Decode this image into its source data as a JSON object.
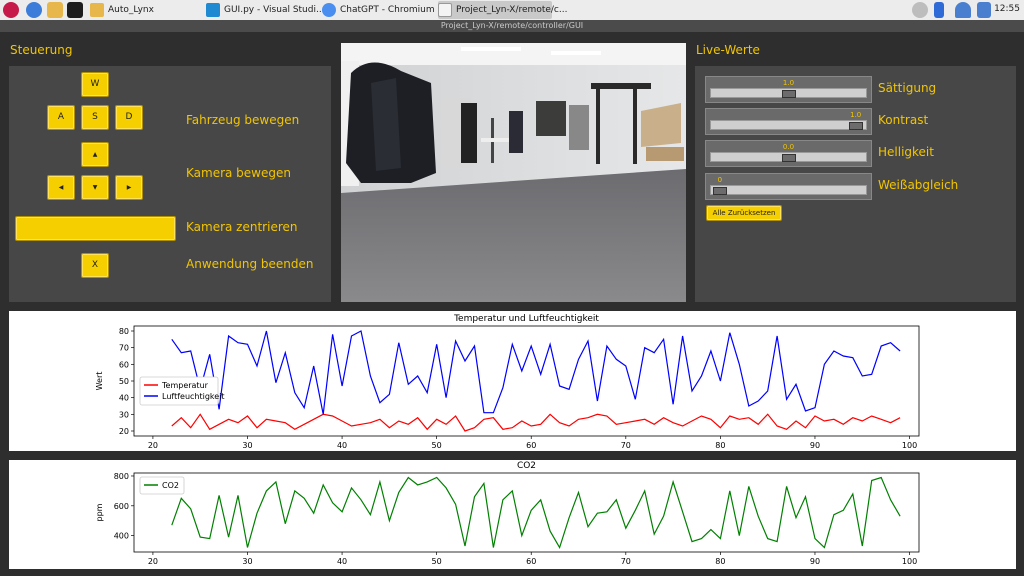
{
  "taskbar": {
    "items": [
      {
        "label": "Auto_Lynx"
      },
      {
        "label": "GUI.py - Visual Studi..."
      },
      {
        "label": "ChatGPT - Chromium"
      },
      {
        "label": "Project_Lyn-X/remote/c..."
      }
    ],
    "clock": "12:55"
  },
  "window": {
    "title": "Project_Lyn-X/remote/controller/GUI"
  },
  "controls": {
    "title": "Steuerung",
    "keys": {
      "w": "W",
      "a": "A",
      "s": "S",
      "d": "D",
      "up": "▲",
      "left": "◀",
      "down": "▼",
      "right": "▶",
      "exit": "X"
    },
    "labels": {
      "move_vehicle": "Fahrzeug bewegen",
      "move_camera": "Kamera bewegen",
      "center_camera": "Kamera zentrieren",
      "exit_app": "Anwendung beenden"
    }
  },
  "live": {
    "title": "Live-Werte",
    "sliders": [
      {
        "label": "Sättigung",
        "value": "1.0",
        "fraction": 0.5
      },
      {
        "label": "Kontrast",
        "value": "1.0",
        "fraction": 0.97
      },
      {
        "label": "Helligkeit",
        "value": "0.0",
        "fraction": 0.5
      },
      {
        "label": "Weißabgleich",
        "value": "0",
        "fraction": 0.02
      }
    ],
    "reset_label": "Alle Zurücksetzen"
  },
  "colors": {
    "accent": "#f2c500",
    "button": "#f6cf00",
    "panel": "#474747",
    "background": "#2e2e2e"
  },
  "chart_data": [
    {
      "type": "line",
      "title": "Temperatur und Luftfeuchtigkeit",
      "xlabel": "",
      "ylabel": "Wert",
      "xlim": [
        18,
        101
      ],
      "ylim": [
        17,
        83
      ],
      "xticks": [
        20,
        30,
        40,
        50,
        60,
        70,
        80,
        90,
        100
      ],
      "yticks": [
        20,
        30,
        40,
        50,
        60,
        70,
        80
      ],
      "legend": "center-left",
      "x": [
        22,
        23,
        24,
        25,
        26,
        27,
        28,
        29,
        30,
        31,
        32,
        33,
        34,
        35,
        36,
        37,
        38,
        39,
        40,
        41,
        42,
        43,
        44,
        45,
        46,
        47,
        48,
        49,
        50,
        51,
        52,
        53,
        54,
        55,
        56,
        57,
        58,
        59,
        60,
        61,
        62,
        63,
        64,
        65,
        66,
        67,
        68,
        69,
        70,
        71,
        72,
        73,
        74,
        75,
        76,
        77,
        78,
        79,
        80,
        81,
        82,
        83,
        84,
        85,
        86,
        87,
        88,
        89,
        90,
        91,
        92,
        93,
        94,
        95,
        96,
        97,
        98,
        99
      ],
      "series": [
        {
          "name": "Temperatur",
          "color": "#ff0000",
          "values": [
            23,
            28,
            22,
            30,
            21,
            24,
            27,
            25,
            29,
            22,
            27,
            26,
            25,
            21,
            24,
            27,
            30,
            29,
            26,
            23,
            24,
            25,
            27,
            22,
            26,
            24,
            28,
            21,
            27,
            24,
            29,
            20,
            22,
            27,
            28,
            21,
            22,
            26,
            23,
            24,
            30,
            25,
            23,
            27,
            28,
            30,
            29,
            24,
            25,
            26,
            27,
            24,
            28,
            25,
            23,
            26,
            29,
            27,
            22,
            29,
            27,
            28,
            24,
            30,
            23,
            21,
            26,
            22,
            29,
            26,
            27,
            24,
            28,
            26,
            29,
            27,
            25,
            28
          ]
        },
        {
          "name": "Luftfeuchtigkeit",
          "color": "#0000ff",
          "values": [
            75,
            67,
            68,
            45,
            66,
            33,
            77,
            73,
            72,
            59,
            80,
            49,
            67,
            43,
            34,
            59,
            30,
            78,
            47,
            77,
            80,
            53,
            37,
            42,
            73,
            48,
            53,
            43,
            72,
            40,
            74,
            62,
            71,
            31,
            31,
            46,
            72,
            56,
            71,
            54,
            72,
            47,
            45,
            63,
            74,
            38,
            71,
            63,
            59,
            39,
            70,
            67,
            75,
            36,
            77,
            44,
            53,
            68,
            50,
            79,
            60,
            35,
            38,
            44,
            77,
            39,
            48,
            32,
            34,
            60,
            68,
            65,
            64,
            53,
            54,
            71,
            73,
            68
          ]
        }
      ]
    },
    {
      "type": "line",
      "title": "CO2",
      "xlabel": "",
      "ylabel": "ppm",
      "xlim": [
        18,
        101
      ],
      "ylim": [
        290,
        820
      ],
      "xticks": [
        20,
        30,
        40,
        50,
        60,
        70,
        80,
        90,
        100
      ],
      "yticks": [
        400,
        600,
        800
      ],
      "legend": "top-left",
      "x": [
        22,
        23,
        24,
        25,
        26,
        27,
        28,
        29,
        30,
        31,
        32,
        33,
        34,
        35,
        36,
        37,
        38,
        39,
        40,
        41,
        42,
        43,
        44,
        45,
        46,
        47,
        48,
        49,
        50,
        51,
        52,
        53,
        54,
        55,
        56,
        57,
        58,
        59,
        60,
        61,
        62,
        63,
        64,
        65,
        66,
        67,
        68,
        69,
        70,
        71,
        72,
        73,
        74,
        75,
        76,
        77,
        78,
        79,
        80,
        81,
        82,
        83,
        84,
        85,
        86,
        87,
        88,
        89,
        90,
        91,
        92,
        93,
        94,
        95,
        96,
        97,
        98,
        99
      ],
      "series": [
        {
          "name": "CO2",
          "color": "#008000",
          "values": [
            470,
            650,
            580,
            390,
            380,
            670,
            390,
            670,
            320,
            550,
            700,
            760,
            480,
            700,
            650,
            550,
            740,
            620,
            560,
            720,
            640,
            540,
            760,
            500,
            690,
            790,
            740,
            760,
            790,
            720,
            610,
            330,
            660,
            750,
            320,
            640,
            700,
            400,
            570,
            640,
            430,
            320,
            520,
            690,
            460,
            550,
            560,
            640,
            450,
            570,
            700,
            410,
            530,
            760,
            560,
            360,
            380,
            440,
            380,
            700,
            400,
            730,
            530,
            380,
            360,
            730,
            520,
            660,
            380,
            320,
            540,
            570,
            680,
            330,
            770,
            790,
            640,
            530
          ]
        }
      ]
    }
  ]
}
